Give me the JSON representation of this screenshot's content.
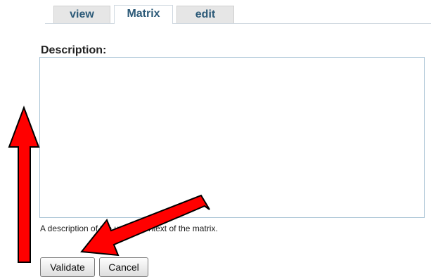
{
  "tabs": [
    {
      "label": "view",
      "active": false
    },
    {
      "label": "Matrix",
      "active": true
    },
    {
      "label": "edit",
      "active": false
    }
  ],
  "form": {
    "description_label": "Description:",
    "description_value": "",
    "description_help": "A description of the usage context of the matrix.",
    "validate_label": "Validate",
    "cancel_label": "Cancel"
  },
  "annotations": [
    {
      "name": "up-arrow-icon",
      "color": "#ff0000",
      "outline": "#000000"
    },
    {
      "name": "diagonal-arrow-icon",
      "color": "#ff0000",
      "outline": "#000000"
    }
  ]
}
